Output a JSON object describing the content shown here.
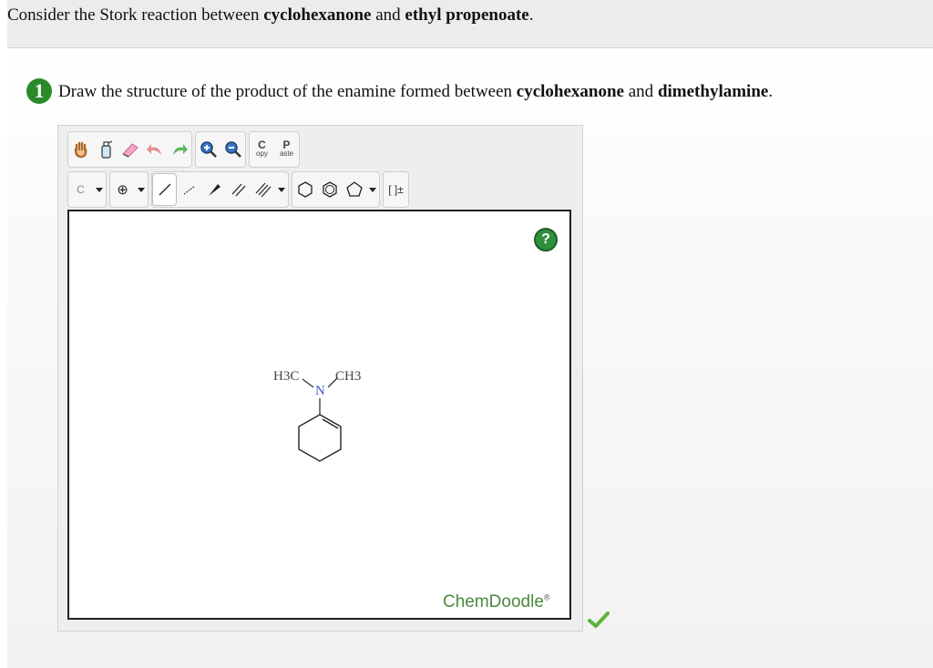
{
  "header": {
    "prefix": "Consider the Stork reaction between ",
    "reagent1": "cyclohexanone",
    "mid": " and ",
    "reagent2": "ethyl propenoate",
    "suffix": "."
  },
  "step": {
    "number": "1",
    "prefix": "Draw the structure of the product of the enamine formed between ",
    "reagent1": "cyclohexanone",
    "mid": " and ",
    "reagent2": "dimethylamine",
    "suffix": "."
  },
  "toolbar": {
    "row1": [
      {
        "name": "pan-hand-icon"
      },
      {
        "name": "clear-bottle-icon"
      },
      {
        "name": "eraser-icon"
      },
      {
        "name": "undo-icon"
      },
      {
        "name": "redo-icon"
      },
      {
        "name": "zoom-in-icon"
      },
      {
        "name": "zoom-out-icon"
      },
      {
        "name": "copy-icon",
        "big": "C",
        "small": "opy"
      },
      {
        "name": "paste-icon",
        "big": "P",
        "small": "aste"
      }
    ],
    "atom_label": "C",
    "charge_symbol": "⊕",
    "bracket_label": "[ ]±"
  },
  "molecule": {
    "left_group": "H3C",
    "right_group": "CH3",
    "n_atom": "N"
  },
  "canvas": {
    "help_label": "?",
    "brand": "ChemDoodle",
    "brand_mark": "®"
  },
  "colors": {
    "badge": "#2a8a2a",
    "help": "#2f8f3a",
    "brand": "#4a8a3e",
    "nitrogen": "#3a57c9",
    "check": "#5fb33c"
  }
}
